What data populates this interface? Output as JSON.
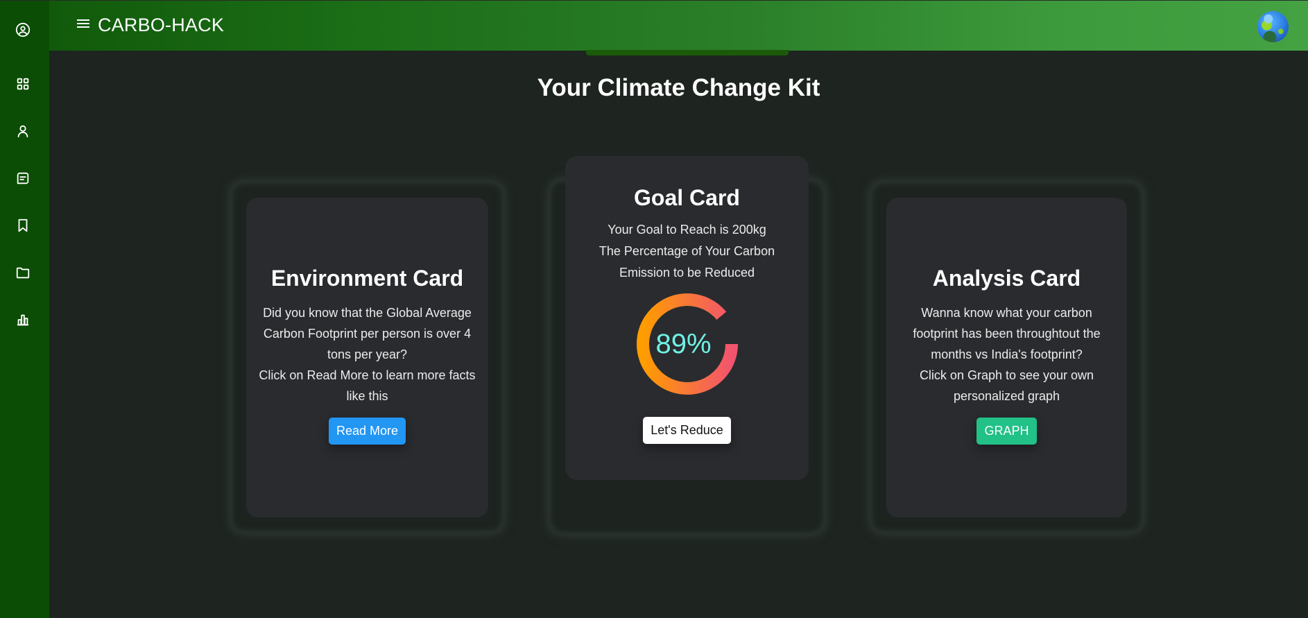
{
  "header": {
    "app_title": "CARBO-HACK",
    "menu_icon": "hamburger-menu-icon",
    "avatar_icon": "globe-earth-icon"
  },
  "sidebar": {
    "items": [
      {
        "name": "profile",
        "icon": "user-circle-icon"
      },
      {
        "name": "dashboard",
        "icon": "grid-icon"
      },
      {
        "name": "user",
        "icon": "user-icon"
      },
      {
        "name": "messages",
        "icon": "message-icon"
      },
      {
        "name": "bookmarks",
        "icon": "bookmark-icon"
      },
      {
        "name": "folder",
        "icon": "folder-icon"
      },
      {
        "name": "analytics",
        "icon": "bar-chart-icon"
      }
    ]
  },
  "main": {
    "title": "Your Climate Change Kit",
    "cards": {
      "environment": {
        "title": "Environment Card",
        "text_1": "Did you know that the Global Average Carbon Footprint per person is over 4 tons per year?",
        "text_2": "Click on Read More to learn more facts like this",
        "button": "Read More",
        "button_color": "#2196f3"
      },
      "goal": {
        "title": "Goal Card",
        "line_1": "Your Goal to Reach is 200kg",
        "line_2": "The Percentage of Your Carbon Emission to be Reduced",
        "progress_label": "89%",
        "progress_value": 0.89,
        "gradient_start": "#ff9d00",
        "gradient_end": "#f2546e",
        "label_color": "#6ff2e3",
        "button": "Let's Reduce"
      },
      "analysis": {
        "title": "Analysis Card",
        "text_1": "Wanna know what your carbon footprint has been throughtout the months vs India's footprint?",
        "text_2": "Click on Graph to see your own personalized graph",
        "button": "GRAPH",
        "button_color": "#21c187"
      }
    }
  }
}
